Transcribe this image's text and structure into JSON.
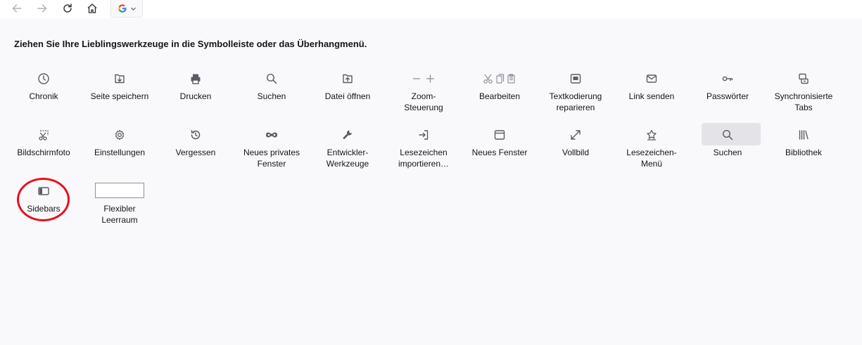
{
  "heading": "Ziehen Sie Ihre Lieblingswerkzeuge in die Symbolleiste oder das Überhangmenü.",
  "toolbar": {
    "back_icon": "arrow-left-icon",
    "forward_icon": "arrow-right-icon",
    "reload_icon": "reload-icon",
    "home_icon": "home-icon",
    "search_engine_icon": "google-icon"
  },
  "items": {
    "chronik": "Chronik",
    "seite_speichern": "Seite speichern",
    "drucken": "Drucken",
    "suchen1": "Suchen",
    "datei_oeffnen": "Datei öffnen",
    "zoom": "Zoom-\nSteuerung",
    "bearbeiten": "Bearbeiten",
    "textkodierung": "Textkodierung\nreparieren",
    "link_senden": "Link senden",
    "passwoerter": "Passwörter",
    "sync_tabs": "Synchronisierte\nTabs",
    "bildschirmfoto": "Bildschirmfoto",
    "einstellungen": "Einstellungen",
    "vergessen": "Vergessen",
    "privates_fenster": "Neues privates\nFenster",
    "entwickler": "Entwickler-\nWerkzeuge",
    "lesezeichen_import": "Lesezeichen\nimportieren…",
    "neues_fenster": "Neues Fenster",
    "vollbild": "Vollbild",
    "lesezeichen_menu": "Lesezeichen-\nMenü",
    "suchen2": "Suchen",
    "bibliothek": "Bibliothek",
    "sidebars": "Sidebars",
    "flexibler_leerraum": "Flexibler\nLeerraum"
  },
  "colors": {
    "background": "#f9f9fb",
    "icon": "#5b5b66",
    "highlight_circle": "#e8101b"
  }
}
